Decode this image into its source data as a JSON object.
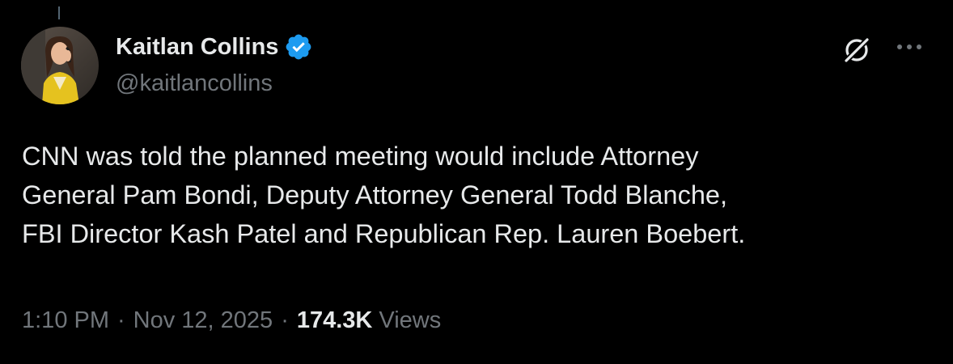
{
  "tweet": {
    "author": {
      "display_name": "Kaitlan Collins",
      "handle": "@kaitlancollins",
      "verified": true,
      "avatar": "profile-photo"
    },
    "text_lines": [
      "CNN was told the planned meeting would include Attorney",
      "General Pam Bondi, Deputy Attorney General Todd Blanche,",
      "FBI Director Kash Patel and Republican Rep. Lauren Boebert."
    ],
    "time": "1:10 PM",
    "date": "Nov 12, 2025",
    "separator": "·",
    "views_count": "174.3K",
    "views_label": "Views"
  },
  "icons": {
    "verified": "verified-badge-icon",
    "grok": "grok-icon",
    "more": "more-options-icon"
  },
  "colors": {
    "background": "#000000",
    "primary_text": "#e7e9ea",
    "secondary_text": "#71767b",
    "verified_blue": "#1d9bf0"
  }
}
